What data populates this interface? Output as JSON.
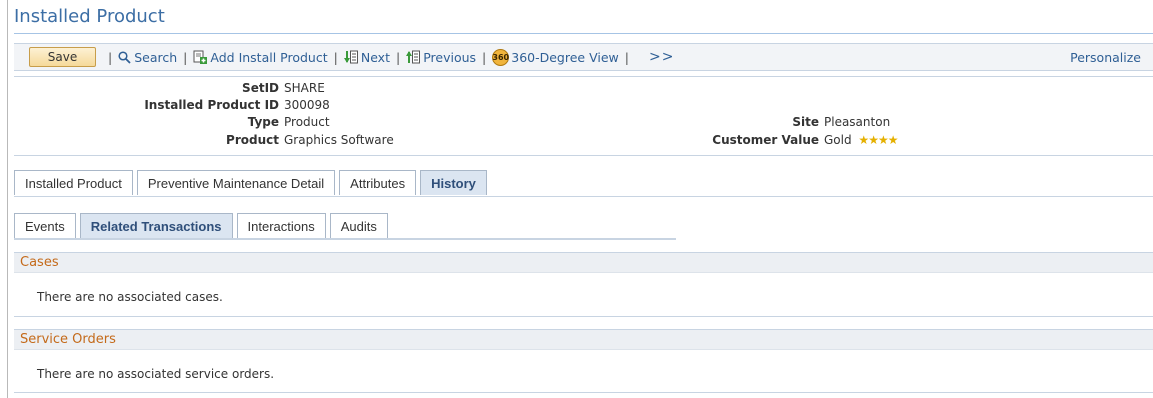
{
  "page": {
    "title": "Installed Product"
  },
  "toolbar": {
    "save_label": "Save",
    "search_label": "Search",
    "add_label": "Add Install Product",
    "next_label": "Next",
    "previous_label": "Previous",
    "view360_label": "360-Degree View",
    "view360_badge": "360",
    "more_label": ">>",
    "personalize_label": "Personalize"
  },
  "info": {
    "setid": {
      "label": "SetID",
      "value": "SHARE"
    },
    "installed_product_id": {
      "label": "Installed Product ID",
      "value": "300098"
    },
    "type": {
      "label": "Type",
      "value": "Product"
    },
    "product": {
      "label": "Product",
      "value": "Graphics Software"
    },
    "site": {
      "label": "Site",
      "value": "Pleasanton"
    },
    "customer_value": {
      "label": "Customer Value",
      "value": "Gold",
      "stars": 4
    }
  },
  "tabs": [
    {
      "label": "Installed Product",
      "active": false
    },
    {
      "label": "Preventive Maintenance Detail",
      "active": false
    },
    {
      "label": "Attributes",
      "active": false
    },
    {
      "label": "History",
      "active": true
    }
  ],
  "subtabs": [
    {
      "label": "Events",
      "active": false
    },
    {
      "label": "Related Transactions",
      "active": true
    },
    {
      "label": "Interactions",
      "active": false
    },
    {
      "label": "Audits",
      "active": false
    }
  ],
  "sections": {
    "cases": {
      "title": "Cases",
      "message": "There are no associated cases."
    },
    "service_orders": {
      "title": "Service Orders",
      "message": "There are no associated service orders."
    }
  },
  "colors": {
    "accent": "#3c6ea5",
    "section_title": "#c46a1a",
    "star": "#e5b000"
  }
}
